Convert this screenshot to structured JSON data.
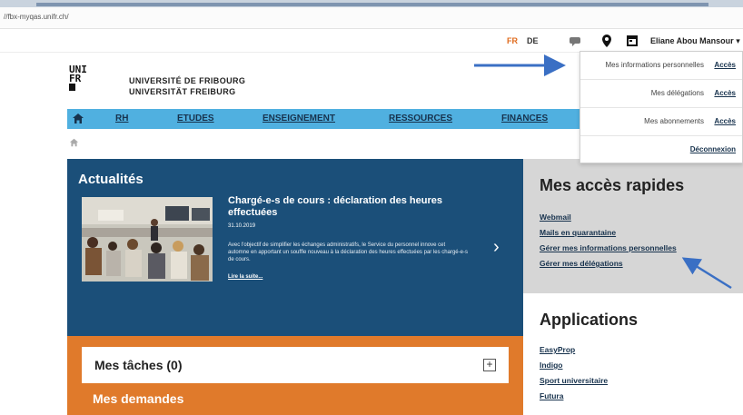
{
  "browser": {
    "url": "//fbx-myqas.unifr.ch/"
  },
  "utility": {
    "lang_fr": "FR",
    "lang_de": "DE",
    "user_name": "Eliane Abou Mansour",
    "icons": [
      "chat-icon",
      "location-pin-icon",
      "calendar-icon",
      "chevron-down-icon"
    ]
  },
  "header": {
    "logo_lines": [
      "UNI",
      "FR"
    ],
    "university_fr": "UNIVERSITÉ DE FRIBOURG",
    "university_de": "UNIVERSITÄT FREIBURG"
  },
  "nav": {
    "items": [
      {
        "label": "RH"
      },
      {
        "label": "ETUDES"
      },
      {
        "label": "ENSEIGNEMENT"
      },
      {
        "label": "RESSOURCES"
      },
      {
        "label": "FINANCES"
      }
    ]
  },
  "news": {
    "heading": "Actualités",
    "title": "Chargé-e-s de cours : déclaration des heures effectuées",
    "date": "31.10.2019",
    "text": "Avec l'objectif de simplifier les échanges administratifs, le Service du personnel innove cet automne en apportant un souffle nouveau à la déclaration des heures effectuées par les chargé-e-s de cours.",
    "more": "Lire la suite..."
  },
  "tasks": {
    "tasks_label": "Mes tâches (0)",
    "requests_label": "Mes demandes"
  },
  "quick_access": {
    "heading": "Mes accès rapides",
    "links": [
      "Webmail",
      "Mails en quarantaine",
      "Gérer mes informations personnelles",
      "Gérer mes délégations"
    ]
  },
  "applications": {
    "heading": "Applications",
    "links": [
      "EasyProp",
      "Indigo",
      "Sport universitaire",
      "Futura"
    ]
  },
  "user_menu": {
    "items": [
      {
        "label": "Mes informations personnelles",
        "action": "Accès"
      },
      {
        "label": "Mes délégations",
        "action": "Accès"
      },
      {
        "label": "Mes abonnements",
        "action": "Accès"
      }
    ],
    "logout": "Déconnexion"
  },
  "colors": {
    "nav_blue": "#50b0e0",
    "news_blue": "#1b4f79",
    "tasks_orange": "#e07a2b",
    "lang_active": "#e06b1d",
    "annotation_arrow": "#3a6fc4"
  }
}
